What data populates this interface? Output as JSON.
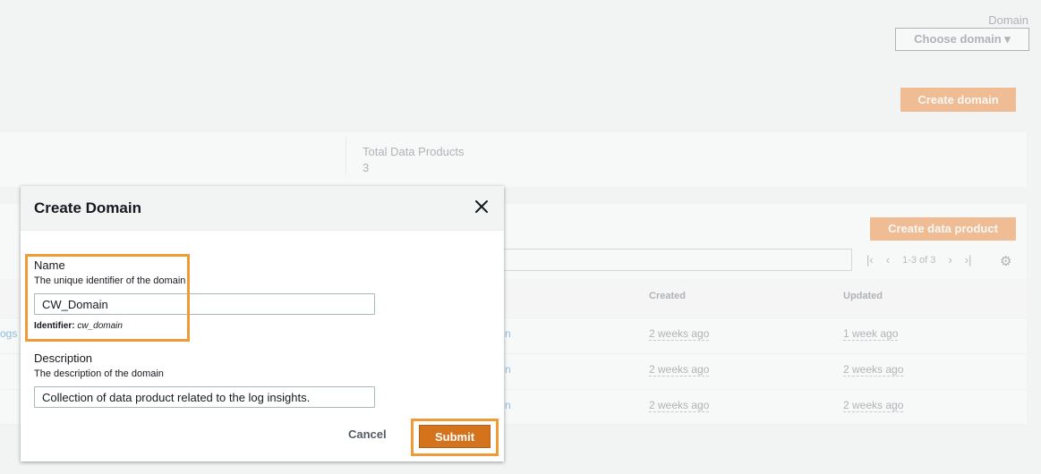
{
  "header": {
    "domain_label": "Domain",
    "choose_domain": "Choose domain ▾"
  },
  "actions": {
    "create_domain": "Create domain",
    "create_data_product": "Create data product"
  },
  "stats": {
    "total_label": "Total Data Products",
    "total_value": "3"
  },
  "table": {
    "pagination": {
      "first": "|‹",
      "prev": "‹",
      "info": "1-3 of 3",
      "next": "›",
      "last": "›|"
    },
    "columns": [
      "Created",
      "Updated"
    ],
    "rows": [
      {
        "left_text": "ogs",
        "link": "n",
        "created": "2 weeks ago",
        "updated": "1 week ago"
      },
      {
        "left_text": "",
        "link": "n",
        "created": "2 weeks ago",
        "updated": "2 weeks ago"
      },
      {
        "left_text": "",
        "link": "n",
        "created": "2 weeks ago",
        "updated": "2 weeks ago"
      }
    ]
  },
  "modal": {
    "title": "Create Domain",
    "name_label": "Name",
    "name_desc": "The unique identifier of the domain",
    "name_value": "CW_Domain",
    "identifier_label": "Identifier:",
    "identifier_value": "cw_domain",
    "description_label": "Description",
    "description_desc": "The description of the domain",
    "description_value": "Collection of data product related to the log insights.",
    "cancel": "Cancel",
    "submit": "Submit"
  },
  "colors": {
    "accent": "#ec7211",
    "highlight": "#f19a38",
    "submit": "#d5731d"
  }
}
